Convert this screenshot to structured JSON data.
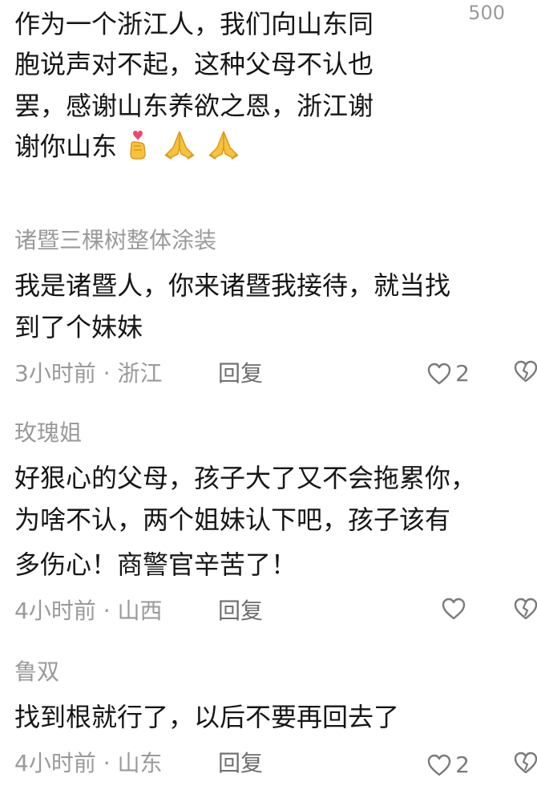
{
  "comments": [
    {
      "body_lines": [
        "作为一个浙江人，我们向山东同",
        "胞说声对不起，这种父母不认也",
        "罢，感谢山东养欲之恩，浙江谢",
        "谢你山东"
      ],
      "count": "500"
    },
    {
      "username": "诸暨三棵树整体涂装",
      "body_lines": [
        "我是诸暨人，你来诸暨我接待，就当找",
        "到了个妹妹"
      ],
      "time": "3小时前 · 浙江",
      "reply": "回复",
      "likes": "2"
    },
    {
      "username": "玫瑰姐",
      "body_lines": [
        "好狠心的父母，孩子大了又不会拖累你，",
        "为啥不认，两个姐妹认下吧，孩子该有",
        "多伤心！商警官辛苦了！"
      ],
      "time": "4小时前 · 山西",
      "reply": "回复",
      "likes": ""
    },
    {
      "username": "鲁双",
      "body_lines": [
        "找到根就行了，以后不要再回去了"
      ],
      "time": "4小时前 · 山东",
      "reply": "回复",
      "likes": "2"
    }
  ],
  "emoji_names": [
    "heart-hand-icon",
    "praying-hands-icon",
    "praying-hands-icon"
  ]
}
